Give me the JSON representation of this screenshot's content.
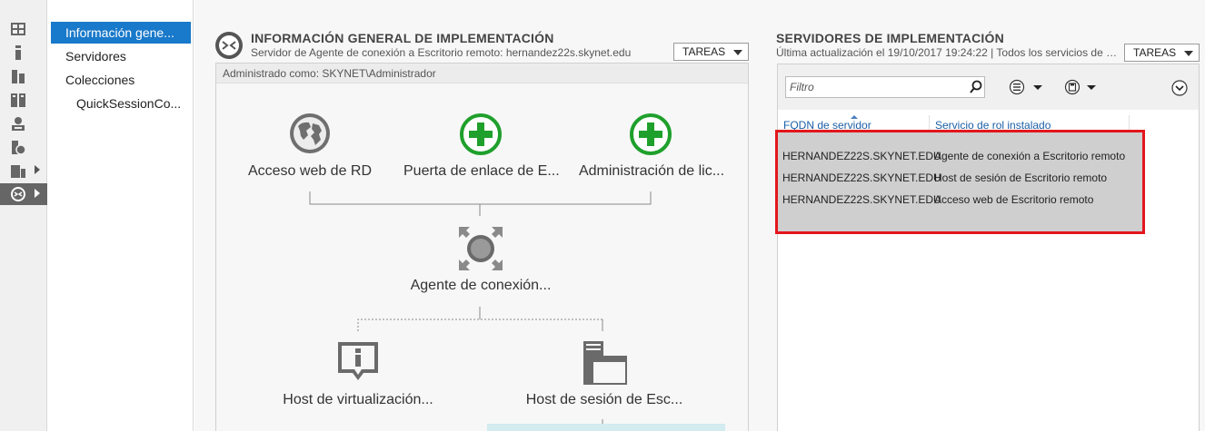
{
  "rail": {
    "items": [
      {
        "icon": "dashboard-icon"
      },
      {
        "icon": "local-server-icon"
      },
      {
        "icon": "all-servers-icon"
      },
      {
        "icon": "file-storage-icon"
      },
      {
        "icon": "ad-ds-icon"
      },
      {
        "icon": "dns-icon"
      },
      {
        "icon": "file-services-icon",
        "expandable": true
      },
      {
        "icon": "remote-desktop-services-icon",
        "expandable": true,
        "active": true
      }
    ]
  },
  "nav": {
    "items": [
      {
        "label": "Información gene...",
        "selected": true
      },
      {
        "label": "Servidores"
      },
      {
        "label": "Colecciones"
      },
      {
        "label": "QuickSessionCo..."
      }
    ]
  },
  "overview": {
    "title": "INFORMACIÓN GENERAL DE IMPLEMENTACIÓN",
    "subtitle": "Servidor de Agente de conexión a Escritorio remoto: hernandez22s.skynet.edu",
    "tasks_label": "TAREAS",
    "admin_text": "Administrado como: SKYNET\\Administrador",
    "nodes": {
      "web_access": "Acceso web de RD",
      "gateway": "Puerta de enlace de E...",
      "licensing": "Administración de lic...",
      "broker": "Agente de conexión...",
      "virtualization": "Host de virtualización...",
      "session_host": "Host de sesión de Esc..."
    }
  },
  "servers": {
    "title": "SERVIDORES DE IMPLEMENTACIÓN",
    "subtitle": "Última actualización el 19/10/2017 19:24:22 | Todos los servicios de ro...",
    "tasks_label": "TAREAS",
    "filter_placeholder": "Filtro",
    "columns": [
      "FQDN de servidor",
      "Servicio de rol instalado"
    ],
    "rows": [
      {
        "fqdn": "HERNANDEZ22S.SKYNET.EDU",
        "role": "Agente de conexión a Escritorio remoto"
      },
      {
        "fqdn": "HERNANDEZ22S.SKYNET.EDU",
        "role": "Host de sesión de Escritorio remoto"
      },
      {
        "fqdn": "HERNANDEZ22S.SKYNET.EDU",
        "role": "Acceso web de Escritorio remoto"
      }
    ]
  },
  "colors": {
    "accent": "#1979ca",
    "add_green": "#1fa02c",
    "highlight_red": "#e3161d",
    "selected_rows": "#cfcfcf"
  }
}
